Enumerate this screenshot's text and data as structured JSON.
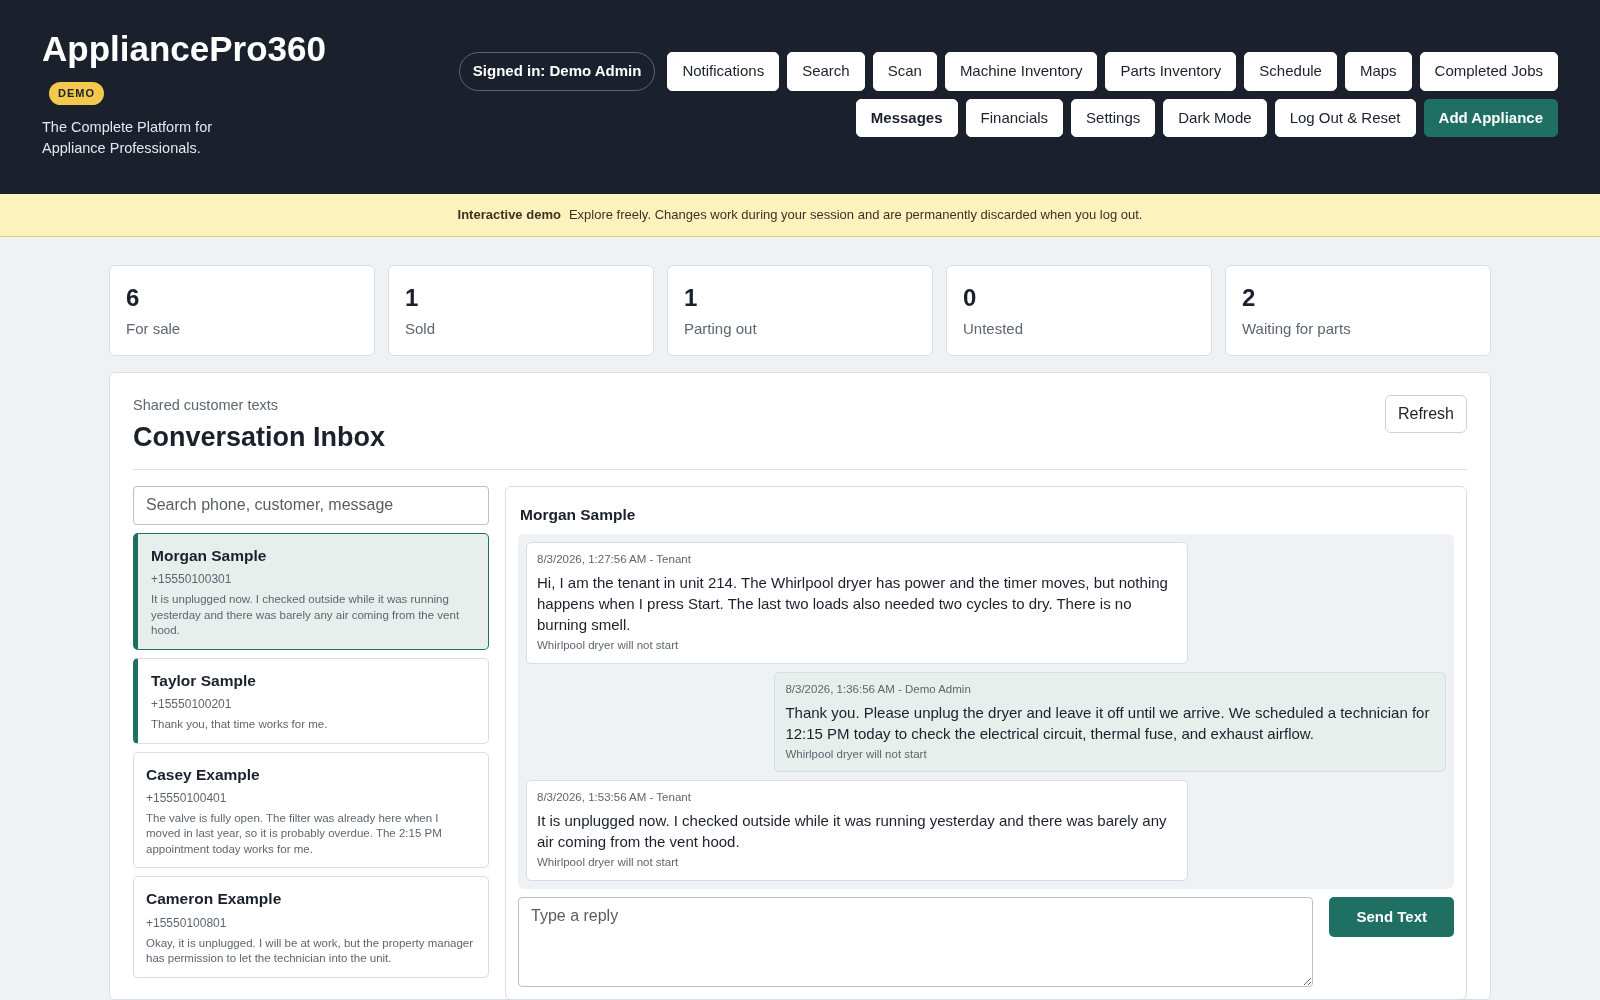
{
  "brand": {
    "title": "AppliancePro360",
    "badge": "DEMO",
    "tagline": "The Complete Platform for Appliance Professionals."
  },
  "signed_in": "Signed in: Demo Admin",
  "nav_rows": [
    [
      {
        "label": "Notifications",
        "selected": false,
        "kind": "plain"
      },
      {
        "label": "Search",
        "selected": false,
        "kind": "plain"
      },
      {
        "label": "Scan",
        "selected": false,
        "kind": "plain"
      },
      {
        "label": "Machine Inventory",
        "selected": false,
        "kind": "plain"
      },
      {
        "label": "Parts Inventory",
        "selected": false,
        "kind": "plain"
      },
      {
        "label": "Schedule",
        "selected": false,
        "kind": "plain"
      },
      {
        "label": "Maps",
        "selected": false,
        "kind": "plain"
      },
      {
        "label": "Completed Jobs",
        "selected": false,
        "kind": "plain"
      }
    ],
    [
      {
        "label": "Messages",
        "selected": true,
        "kind": "plain"
      },
      {
        "label": "Financials",
        "selected": false,
        "kind": "plain"
      },
      {
        "label": "Settings",
        "selected": false,
        "kind": "plain"
      },
      {
        "label": "Dark Mode",
        "selected": false,
        "kind": "plain"
      },
      {
        "label": "Log Out & Reset",
        "selected": false,
        "kind": "plain"
      },
      {
        "label": "Add Appliance",
        "selected": false,
        "kind": "primary"
      }
    ]
  ],
  "demo_banner": {
    "label": "Interactive demo",
    "text": "Explore freely. Changes work during your session and are permanently discarded when you log out."
  },
  "stats": [
    {
      "value": "6",
      "label": "For sale"
    },
    {
      "value": "1",
      "label": "Sold"
    },
    {
      "value": "1",
      "label": "Parting out"
    },
    {
      "value": "0",
      "label": "Untested"
    },
    {
      "value": "2",
      "label": "Waiting for parts"
    }
  ],
  "inbox": {
    "eyebrow": "Shared customer texts",
    "title": "Conversation Inbox",
    "refresh": "Refresh",
    "search": {
      "placeholder": "Search phone, customer, message"
    },
    "conversations": [
      {
        "name": "Morgan Sample",
        "phone": "+15550100301",
        "preview": "It is unplugged now. I checked outside while it was running yesterday and there was barely any air coming from the vent hood.",
        "selected": true,
        "unread": false
      },
      {
        "name": "Taylor Sample",
        "phone": "+15550100201",
        "preview": "Thank you, that time works for me.",
        "selected": false,
        "unread": true
      },
      {
        "name": "Casey Example",
        "phone": "+15550100401",
        "preview": "The valve is fully open. The filter was already here when I moved in last year, so it is probably overdue. The 2:15 PM appointment today works for me.",
        "selected": false,
        "unread": false
      },
      {
        "name": "Cameron Example",
        "phone": "+15550100801",
        "preview": "Okay, it is unplugged. I will be at work, but the property manager has permission to let the technician into the unit.",
        "selected": false,
        "unread": false
      }
    ],
    "thread": {
      "title": "Morgan Sample",
      "messages": [
        {
          "meta": "8/3/2026, 1:27:56 AM - Tenant",
          "text": "Hi, I am the tenant in unit 214. The Whirlpool dryer has power and the timer moves, but nothing happens when I press Start. The last two loads also needed two cycles to dry. There is no burning smell.",
          "job": "Whirlpool dryer will not start",
          "outgoing": false
        },
        {
          "meta": "8/3/2026, 1:36:56 AM - Demo Admin",
          "text": "Thank you. Please unplug the dryer and leave it off until we arrive. We scheduled a technician for 12:15 PM today to check the electrical circuit, thermal fuse, and exhaust airflow.",
          "job": "Whirlpool dryer will not start",
          "outgoing": true
        },
        {
          "meta": "8/3/2026, 1:53:56 AM - Tenant",
          "text": "It is unplugged now. I checked outside while it was running yesterday and there was barely any air coming from the vent hood.",
          "job": "Whirlpool dryer will not start",
          "outgoing": false
        }
      ],
      "reply": {
        "placeholder": "Type a reply"
      },
      "send": "Send Text"
    }
  }
}
